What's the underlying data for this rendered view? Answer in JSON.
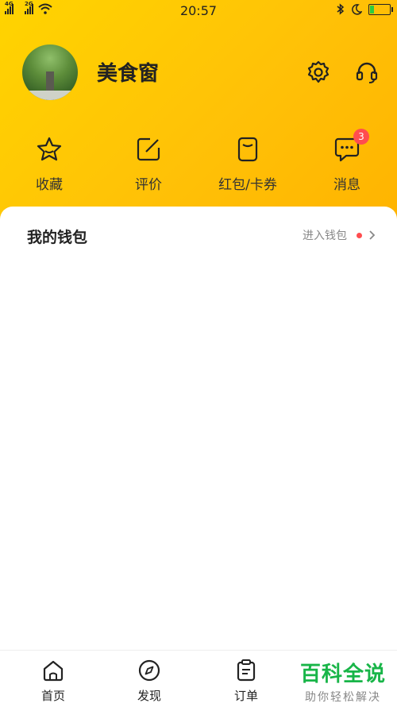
{
  "status_bar": {
    "network_1": "4G",
    "network_2": "2G",
    "time": "20:57",
    "battery_level": 0.18
  },
  "profile": {
    "username": "美食窗"
  },
  "quick_actions": [
    {
      "label": "收藏",
      "icon": "star-icon"
    },
    {
      "label": "评价",
      "icon": "edit-icon"
    },
    {
      "label": "红包/卡券",
      "icon": "coupon-icon"
    },
    {
      "label": "消息",
      "icon": "message-icon",
      "badge": "3"
    }
  ],
  "wallet": {
    "title": "我的钱包",
    "link": "进入钱包"
  },
  "tabbar": [
    {
      "label": "首页",
      "icon": "home-icon"
    },
    {
      "label": "发现",
      "icon": "compass-icon"
    },
    {
      "label": "订单",
      "icon": "orders-icon"
    }
  ],
  "watermark": {
    "main": "百科全说",
    "sub": "助你轻松解决"
  },
  "colors": {
    "header_start": "#ffd400",
    "header_end": "#ffb300",
    "badge": "#ff4d4f",
    "watermark_green": "#18b548"
  }
}
